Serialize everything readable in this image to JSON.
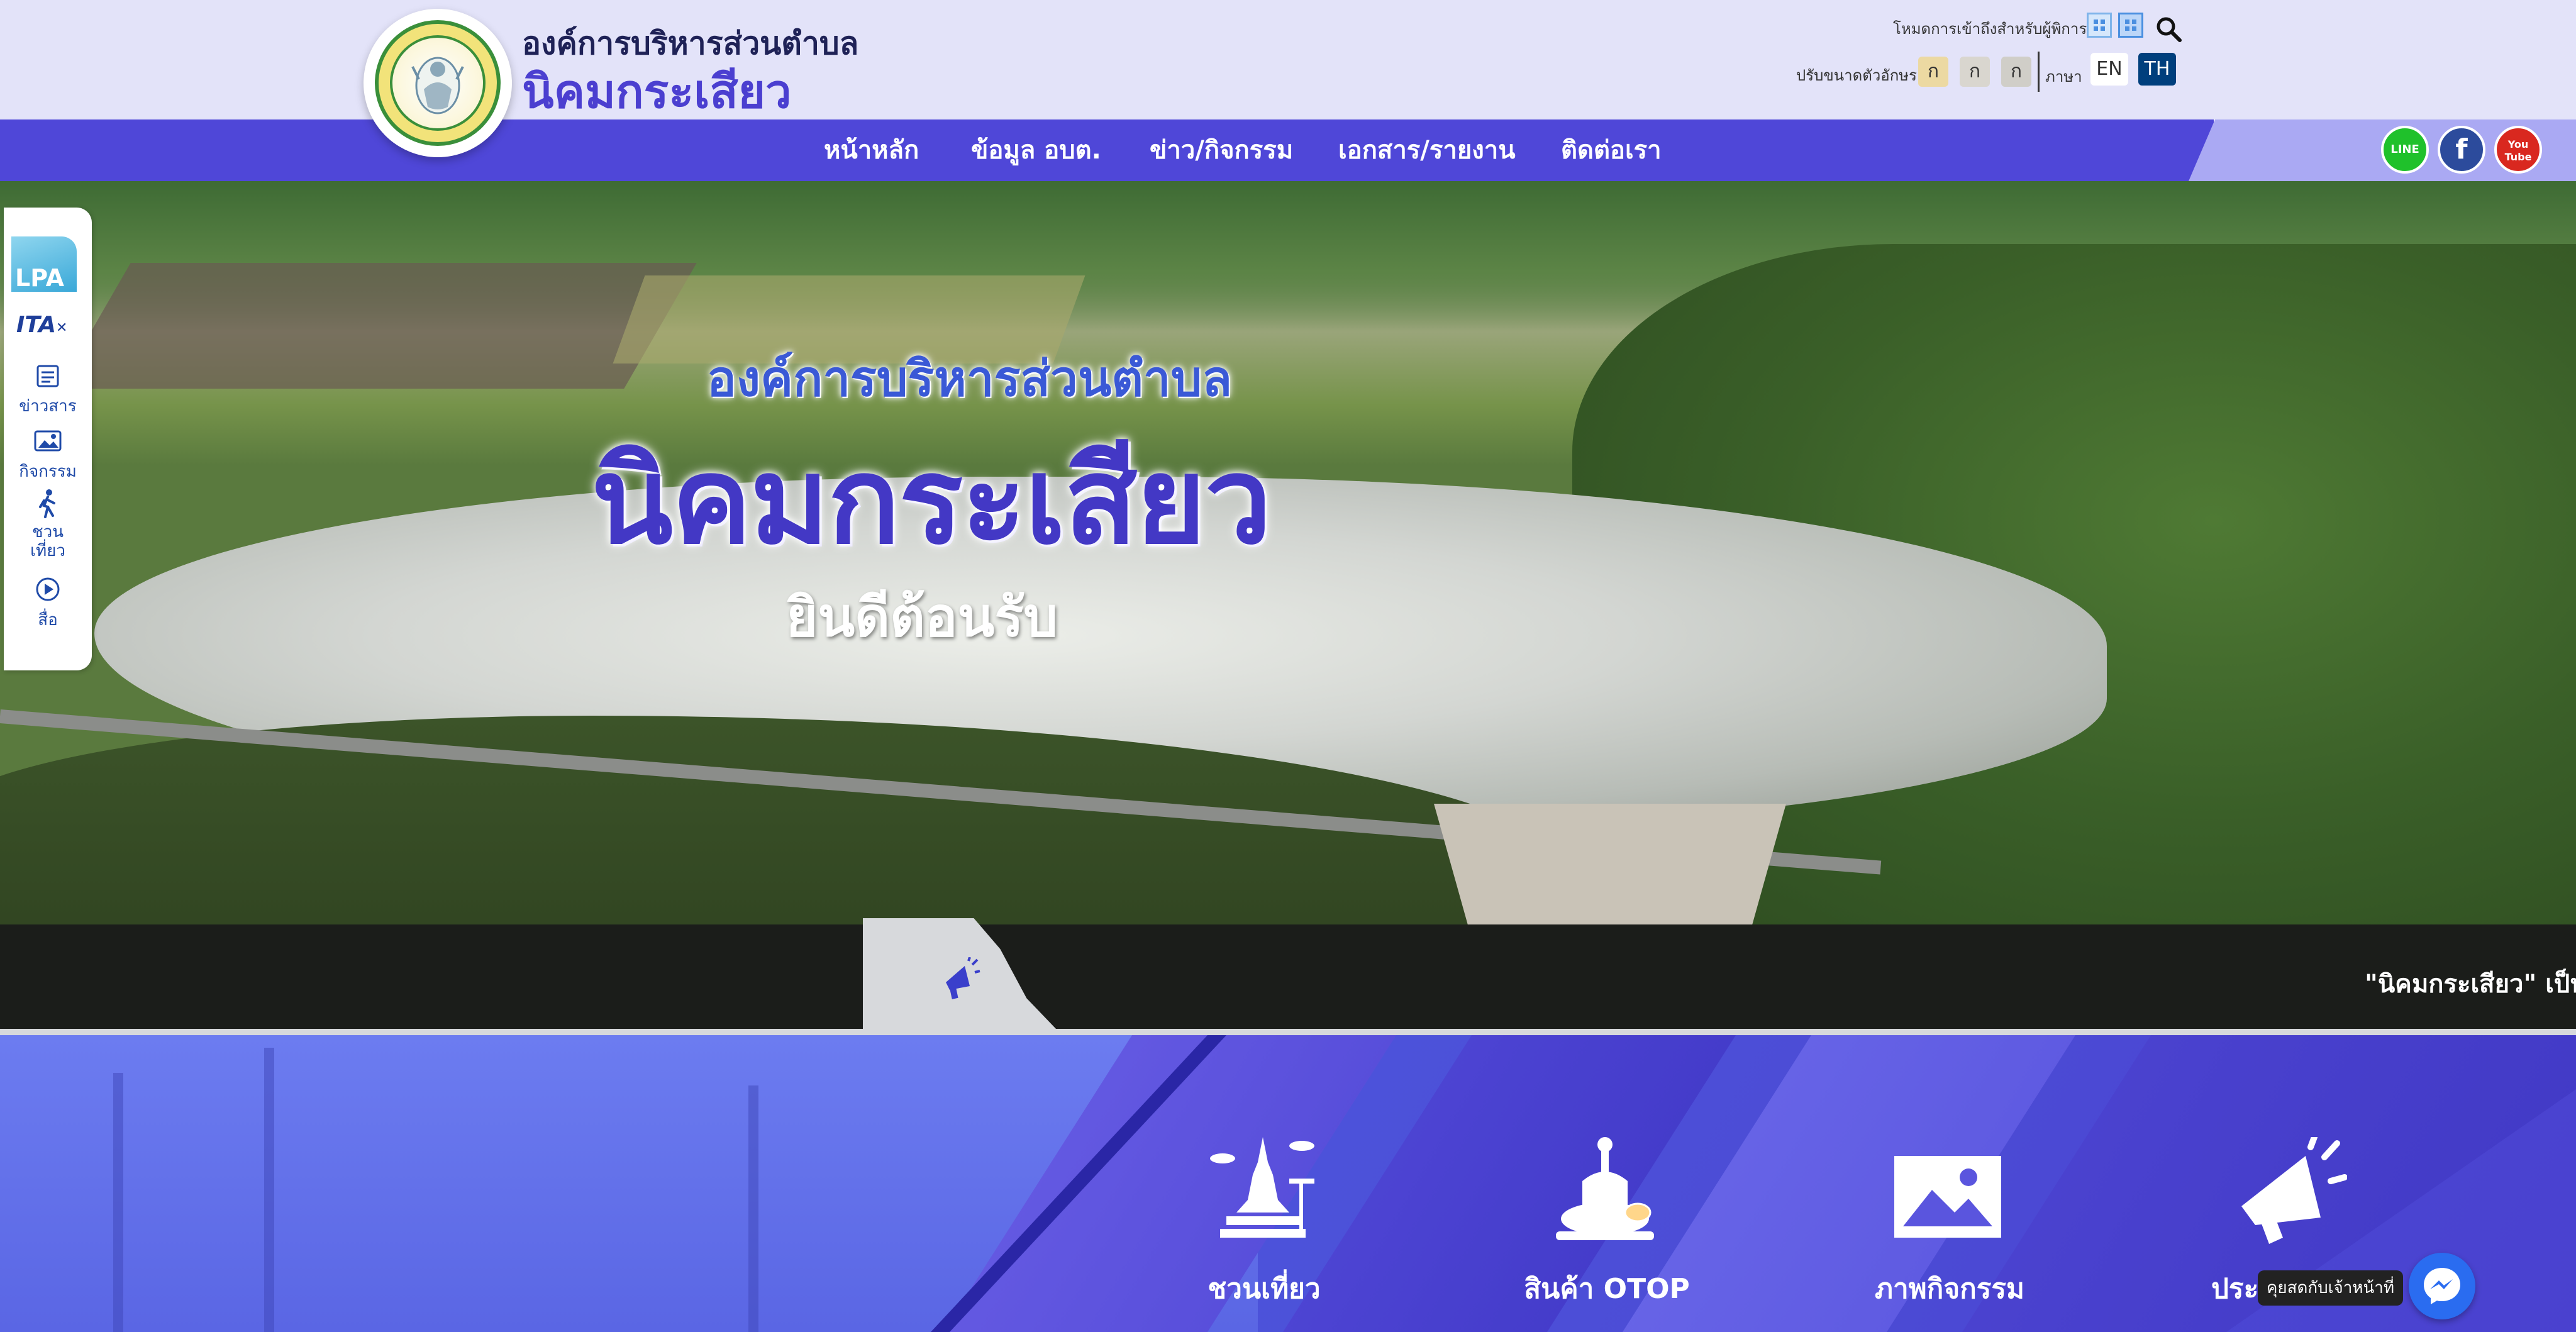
{
  "header": {
    "org_line1": "องค์การบริหารส่วนตำบล",
    "org_line2": "นิคมกระเสียว",
    "accessibility_label": "โหมดการเข้าถึงสำหรับผู้พิการ",
    "font_size_label": "ปรับขนาดตัวอักษร",
    "font_buttons": [
      "ก",
      "ก",
      "ก"
    ],
    "language_label": "ภาษา",
    "languages": [
      "EN",
      "TH"
    ],
    "active_language": "TH"
  },
  "nav": {
    "items": [
      "หน้าหลัก",
      "ข้อมูล อบต.",
      "ข่าว/กิจกรรม",
      "เอกสาร/รายงาน",
      "ติดต่อเรา"
    ],
    "social": {
      "line": "LINE",
      "facebook": "f",
      "youtube": "You Tube"
    }
  },
  "hero": {
    "subtitle": "องค์การบริหารส่วนตำบล",
    "title": "นิคมกระเสียว",
    "welcome": "ยินดีต้อนรับ"
  },
  "side_menu": {
    "lpa": "LPA",
    "itax": "ITA",
    "items": [
      "ข่าวสาร",
      "กิจกรรม",
      "ชวน เที่ยว",
      "สื่อ"
    ]
  },
  "ticker": {
    "text": "\"นิคมกระเสียว\" เป็นเ"
  },
  "services": {
    "items": [
      "ชวนเที่ยว",
      "สินค้า OTOP",
      "ภาพกิจกรรม",
      "ประ"
    ]
  },
  "chat": {
    "tooltip": "คุยสดกับเจ้าหน้าที่"
  },
  "colors": {
    "header_bg": "#e3e3f9",
    "nav_bg": "#4f47d8",
    "title_purple": "#4338c5",
    "services_bg": "#4d56dc"
  }
}
